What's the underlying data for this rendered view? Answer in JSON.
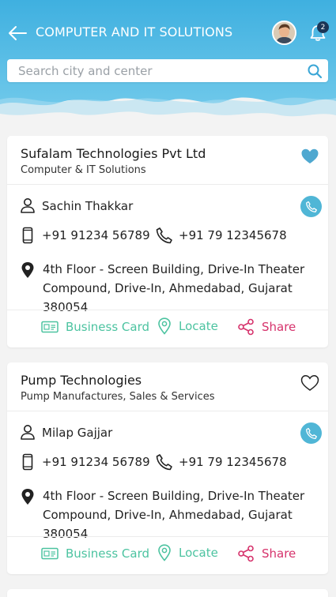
{
  "header": {
    "title": "COMPUTER AND IT SOLUTIONS",
    "notification_count": "2"
  },
  "search": {
    "placeholder": "Search city and center"
  },
  "colors": {
    "header": "#44b2df",
    "accent_teal": "#4cc3a0",
    "share_pink": "#d6336c",
    "call_blue": "#50b6d6",
    "favorite": "#4fa8d0"
  },
  "listings": [
    {
      "name": "Sufalam Technologies Pvt Ltd",
      "category": "Computer & IT Solutions",
      "favorite": true,
      "contact_person": "Sachin Thakkar",
      "mobile": "+91 91234 56789",
      "phone": "+91 79 12345678",
      "address": "4th Floor - Screen Building, Drive-In Theater Compound, Drive-In, Ahmedabad, Gujarat 380054",
      "actions": {
        "card": "Business Card",
        "locate": "Locate",
        "share": "Share"
      }
    },
    {
      "name": "Pump Technologies",
      "category": "Pump Manufactures, Sales & Services",
      "favorite": false,
      "contact_person": "Milap Gajjar",
      "mobile": "+91 91234 56789",
      "phone": "+91 79 12345678",
      "address": "4th Floor - Screen Building, Drive-In Theater Compound, Drive-In, Ahmedabad, Gujarat 380054",
      "actions": {
        "card": "Business Card",
        "locate": "Locate",
        "share": "Share"
      }
    }
  ]
}
